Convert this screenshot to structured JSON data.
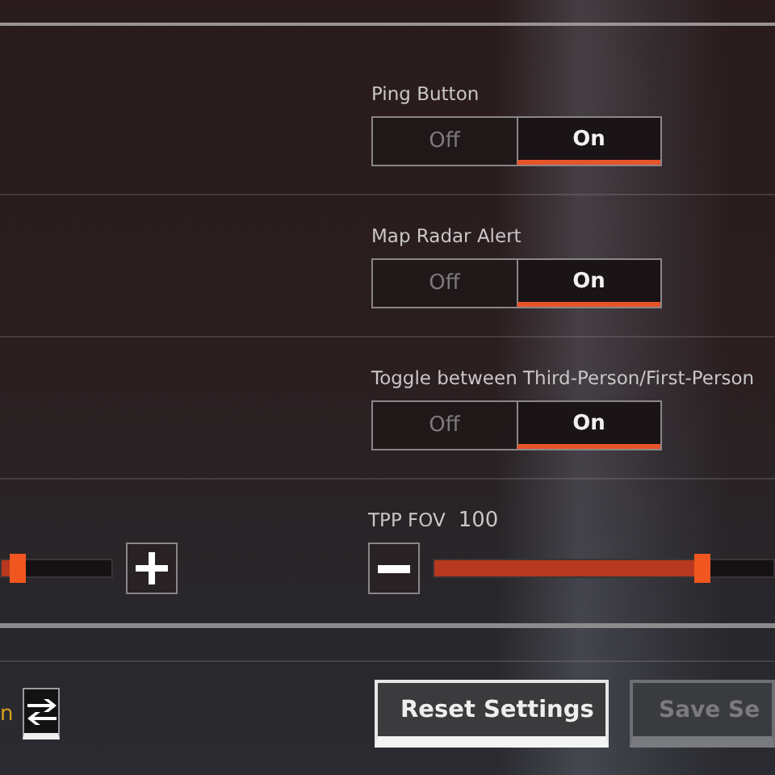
{
  "toggles": [
    {
      "label": "Ping Button",
      "options": [
        {
          "label": "Off",
          "selected": false
        },
        {
          "label": "On",
          "selected": true
        }
      ]
    },
    {
      "label": "Map Radar Alert",
      "options": [
        {
          "label": "Off",
          "selected": false
        },
        {
          "label": "On",
          "selected": true
        }
      ]
    },
    {
      "label": "Toggle between Third-Person/First-Person",
      "options": [
        {
          "label": "Off",
          "selected": false
        },
        {
          "label": "On",
          "selected": true
        }
      ]
    }
  ],
  "sliders": [
    {
      "level": 0.15
    },
    {
      "label": "TPP FOV",
      "reading": "100",
      "level": 0.79
    }
  ],
  "footer": {
    "cut_label": "n",
    "buttons": [
      {
        "label": "Reset Settings",
        "disabled": false
      },
      {
        "label": "Save Se",
        "disabled": true
      }
    ]
  }
}
